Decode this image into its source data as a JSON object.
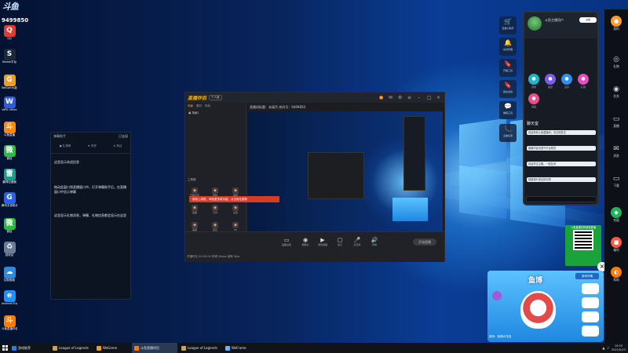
{
  "top_logo": {
    "text": "斗鱼",
    "count": "9499850"
  },
  "desktop_icons": [
    {
      "label": "QQ",
      "color": "#e23a2c",
      "glyph": "Q"
    },
    {
      "label": "Steam平台",
      "color": "#1b2838",
      "glyph": "S"
    },
    {
      "label": "WeGame游戏",
      "color": "#e8a21a",
      "glyph": "G"
    },
    {
      "label": "WPS Office",
      "color": "#2f5bd6",
      "glyph": "W"
    },
    {
      "label": "斗鱼直播",
      "color": "#ff8a00",
      "glyph": "斗"
    },
    {
      "label": "微信",
      "color": "#2dbb3e",
      "glyph": "微"
    },
    {
      "label": "雷神加速器",
      "color": "#12a28c",
      "glyph": "雷"
    },
    {
      "label": "腾讯手游助手",
      "color": "#2563eb",
      "glyph": "G"
    },
    {
      "label": "微信",
      "color": "#2dbb3e",
      "glyph": "微"
    },
    {
      "label": "回收站",
      "color": "#6b7d94",
      "glyph": "♻"
    },
    {
      "label": "控制面板",
      "color": "#2c8ae0",
      "glyph": "☁"
    },
    {
      "label": "Internet Explorer",
      "color": "#1e90ff",
      "glyph": "e"
    },
    {
      "label": "斗鱼直播伴侣",
      "color": "#ff7a00",
      "glyph": "斗"
    }
  ],
  "chat_panel": {
    "header_left": "弹幕助手",
    "header_right": "已连接",
    "tabs": [
      "礼物榜",
      "贵宾",
      "粉丝"
    ],
    "messages": [
      "这里显示欢迎信息",
      "拖动此窗口到直播窗口中，打开弹幕助手后，在直播窗口中显示弹幕",
      "这里显示礼物消息，弹幕、礼物信息都会显示在这里"
    ]
  },
  "app": {
    "logo": "直播伴侣",
    "badge": "个人版",
    "left_tabs": [
      "场景",
      "素材",
      "特效"
    ],
    "scene_label": "场景1",
    "tools_label": "工具箱",
    "banner": "新版上线啦，体验更多新功能，点击前往更新",
    "path": "直播间标题：未填写 房间号：9499850",
    "status": "开播时长 00:00:00  码率 0kbps  帧率 0fps",
    "start_live": "开始直播",
    "tools": [
      "开播设置",
      "录制",
      "弹幕",
      "截图",
      "分享",
      "设置",
      "美颜",
      "连麦",
      "PK"
    ],
    "bottom_controls": [
      "画面设置",
      "摄像头",
      "游戏进程",
      "窗口",
      "麦克风",
      "音响"
    ]
  },
  "right_tools": [
    {
      "label": "直播小助手",
      "icon": "🛒"
    },
    {
      "label": "房间管理",
      "icon": "🔔"
    },
    {
      "label": "开播工具",
      "icon": "🔖"
    },
    {
      "label": "我的活动",
      "icon": "🔖"
    },
    {
      "label": "弹幕工具",
      "icon": "💬"
    },
    {
      "label": "主播任务",
      "icon": "📞"
    }
  ],
  "user_panel": {
    "name": "斗鱼主播用户",
    "badge": "主播",
    "circles": [
      "音效",
      "贴纸",
      "道具",
      "礼物",
      "动画"
    ],
    "chat_title": "聊天室",
    "chat_messages": [
      "欢迎来到斗鱼直播间，请文明发言",
      "直播内容请遵守平台规范",
      "欢迎关注主播，一起互动",
      "感谢观众送出的礼物"
    ]
  },
  "right_sidebar": [
    "我的",
    "礼物",
    "任务",
    "直播",
    "消息",
    "下载",
    "充值",
    "福利",
    "帮助"
  ],
  "qr_box": {
    "title": "斗鱼直播扫码观看直播"
  },
  "game_ad": {
    "title": "鱼博",
    "header": "游戏详情",
    "bottom": "游戏：鱼博大作战"
  },
  "taskbar": {
    "tasks": [
      {
        "label": "游戏推荐",
        "color": "#2c7be5"
      },
      {
        "label": "League of Legends",
        "color": "#c8a45a"
      },
      {
        "label": "WeGame",
        "color": "#e8a21a"
      },
      {
        "label": "斗鱼直播伴侣",
        "color": "#ff7a00"
      },
      {
        "label": "League of Legends",
        "color": "#c8a45a"
      },
      {
        "label": "WeFrame",
        "color": "#5fb6ff"
      }
    ],
    "time": "19:25",
    "date": "2021/5/23"
  }
}
